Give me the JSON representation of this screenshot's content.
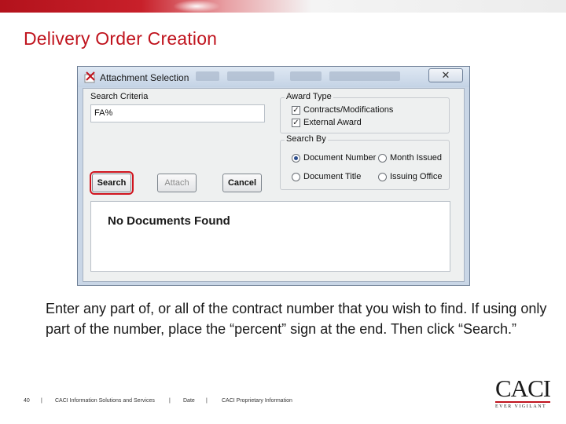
{
  "slide": {
    "title": "Delivery Order Creation",
    "instruction": "Enter any part of, or all of the contract number that you wish to find.  If using only part of the number, place the “percent” sign at the end.  Then click “Search.”"
  },
  "window": {
    "title": "Attachment Selection",
    "close_glyph": "✕",
    "search_criteria": {
      "label": "Search Criteria",
      "value": "FA%"
    },
    "award_type": {
      "label": "Award Type",
      "options": [
        {
          "label": "Contracts/Modifications",
          "checked": true
        },
        {
          "label": "External Award",
          "checked": true
        }
      ]
    },
    "search_by": {
      "label": "Search By",
      "options": [
        {
          "label": "Document Number",
          "selected": true
        },
        {
          "label": "Month Issued",
          "selected": false
        },
        {
          "label": "Document Title",
          "selected": false
        },
        {
          "label": "Issuing Office",
          "selected": false
        }
      ]
    },
    "buttons": {
      "search": "Search",
      "attach": "Attach",
      "cancel": "Cancel"
    },
    "results_message": "No Documents Found"
  },
  "footer": {
    "page_number": "40",
    "separator": "|",
    "company": "CACI Information Solutions and Services",
    "date": "Date",
    "proprietary": "CACI Proprietary Information"
  },
  "logo": {
    "name": "CACI",
    "tagline": "EVER VIGILANT"
  },
  "colors": {
    "accent_red": "#c0141e",
    "window_frame": "#c9d6e6"
  }
}
